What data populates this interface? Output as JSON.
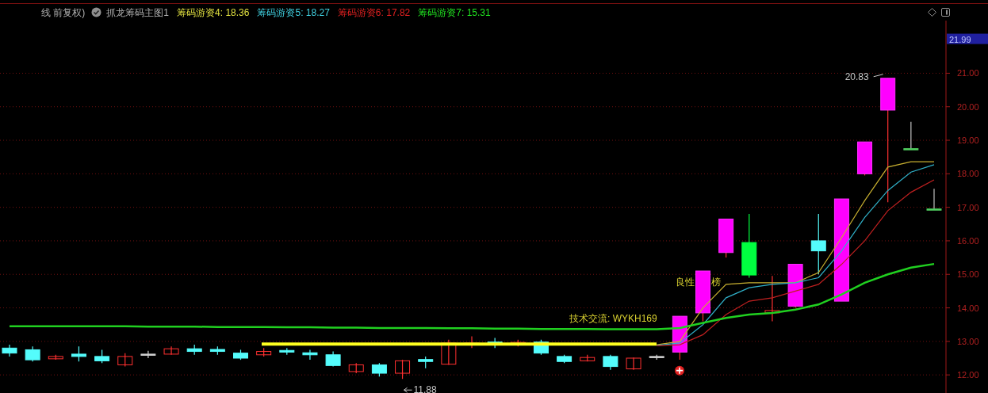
{
  "legend": {
    "period": "线 前复权)",
    "indicator": "抓龙筹码主图1",
    "separator": ":",
    "items": [
      {
        "value": "18.36",
        "color": "#e0e040"
      },
      {
        "value": "18.27",
        "color": "#40d0e0"
      },
      {
        "value": "17.82",
        "color": "#e02020"
      },
      {
        "value": "15.31",
        "color": "#20e020"
      }
    ]
  },
  "price_marker": "21.99",
  "notes": [
    {
      "kind": "contact",
      "text": "技术交流: WYKH169"
    },
    {
      "kind": "tag",
      "text": "良性"
    },
    {
      "kind": "tag_tail",
      "text": "榜"
    }
  ],
  "chart_data": {
    "type": "line",
    "grid": true,
    "ylim": [
      11.46,
      22.57
    ],
    "yticks": [
      {
        "value": 12,
        "label": "12.00"
      },
      {
        "value": 13,
        "label": "13.00"
      },
      {
        "value": 14,
        "label": "14.00"
      },
      {
        "value": 15,
        "label": "15.00"
      },
      {
        "value": 16,
        "label": "16.00"
      },
      {
        "value": 17,
        "label": "17.00"
      },
      {
        "value": 18,
        "label": "18.00"
      },
      {
        "value": 19,
        "label": "19.00"
      },
      {
        "value": 20,
        "label": "20.00"
      },
      {
        "value": 21,
        "label": "21.00"
      }
    ],
    "ref_lines": [
      {
        "axis": "y",
        "value": 12.92,
        "color": "#ffff20"
      }
    ],
    "series": [
      {
        "name": "筹码游资4",
        "color": "#c8b030",
        "values": [
          null,
          null,
          null,
          null,
          null,
          null,
          null,
          null,
          null,
          null,
          null,
          null,
          null,
          null,
          null,
          null,
          null,
          null,
          null,
          null,
          null,
          null,
          null,
          null,
          null,
          null,
          null,
          null,
          12.9,
          13.0,
          14.0,
          14.7,
          14.75,
          14.75,
          14.75,
          15.05,
          16.1,
          17.2,
          18.2,
          18.36,
          18.36
        ]
      },
      {
        "name": "筹码游资5",
        "color": "#30b0c8",
        "values": [
          null,
          null,
          null,
          null,
          null,
          null,
          null,
          null,
          null,
          null,
          null,
          null,
          null,
          null,
          null,
          null,
          null,
          null,
          null,
          null,
          null,
          null,
          null,
          null,
          null,
          null,
          null,
          null,
          12.88,
          12.95,
          13.5,
          14.3,
          14.6,
          14.7,
          14.75,
          14.9,
          15.7,
          16.7,
          17.5,
          18.05,
          18.27
        ]
      },
      {
        "name": "筹码游资6",
        "color": "#c02020",
        "values": [
          null,
          null,
          null,
          null,
          null,
          null,
          null,
          null,
          null,
          null,
          null,
          null,
          null,
          null,
          null,
          null,
          null,
          null,
          null,
          null,
          null,
          null,
          null,
          null,
          null,
          null,
          null,
          null,
          12.87,
          12.9,
          13.2,
          13.8,
          14.2,
          14.3,
          14.5,
          14.7,
          15.3,
          16.0,
          16.9,
          17.45,
          17.82
        ]
      },
      {
        "name": "筹码游资7",
        "color": "#20d020",
        "values": [
          13.45,
          13.45,
          13.45,
          13.45,
          13.45,
          13.45,
          13.44,
          13.44,
          13.44,
          13.43,
          13.43,
          13.43,
          13.42,
          13.42,
          13.41,
          13.41,
          13.4,
          13.4,
          13.4,
          13.39,
          13.39,
          13.38,
          13.38,
          13.37,
          13.37,
          13.37,
          13.36,
          13.36,
          13.36,
          13.4,
          13.55,
          13.7,
          13.8,
          13.85,
          13.95,
          14.1,
          14.4,
          14.75,
          15.0,
          15.2,
          15.31
        ]
      }
    ],
    "annotations": [
      "20.83",
      "11.88"
    ]
  }
}
